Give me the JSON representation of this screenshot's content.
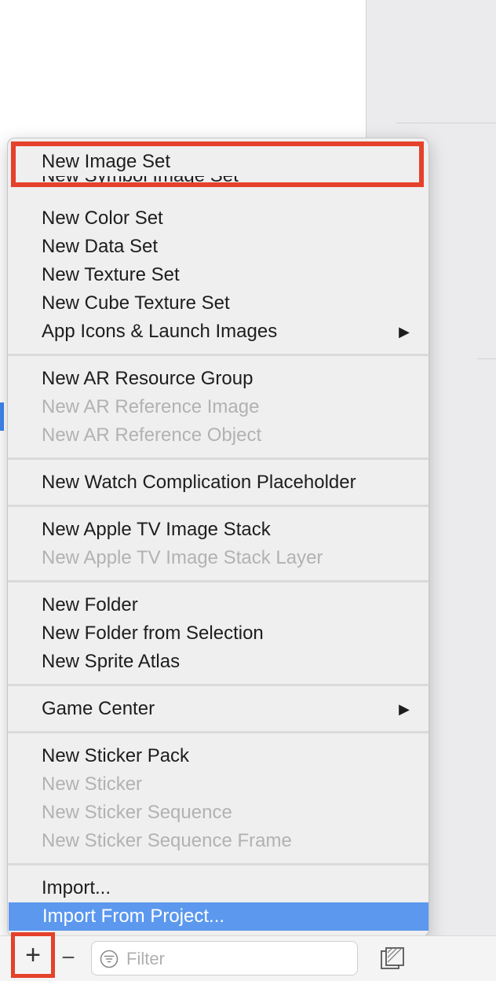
{
  "menu": {
    "items": [
      {
        "label": "New Image Set",
        "enabled": true
      },
      {
        "label": "New Symbol Image Set",
        "enabled": true
      },
      {
        "label": "New Color Set",
        "enabled": true
      },
      {
        "label": "New Data Set",
        "enabled": true
      },
      {
        "label": "New Texture Set",
        "enabled": true
      },
      {
        "label": "New Cube Texture Set",
        "enabled": true
      },
      {
        "label": "App Icons & Launch Images",
        "enabled": true,
        "submenu": true
      },
      {
        "label": "New AR Resource Group",
        "enabled": true
      },
      {
        "label": "New AR Reference Image",
        "enabled": false
      },
      {
        "label": "New AR Reference Object",
        "enabled": false
      },
      {
        "label": "New Watch Complication Placeholder",
        "enabled": true
      },
      {
        "label": "New Apple TV Image Stack",
        "enabled": true
      },
      {
        "label": "New Apple TV Image Stack Layer",
        "enabled": false
      },
      {
        "label": "New Folder",
        "enabled": true
      },
      {
        "label": "New Folder from Selection",
        "enabled": true
      },
      {
        "label": "New Sprite Atlas",
        "enabled": true
      },
      {
        "label": "Game Center",
        "enabled": true,
        "submenu": true
      },
      {
        "label": "New Sticker Pack",
        "enabled": true
      },
      {
        "label": "New Sticker",
        "enabled": false
      },
      {
        "label": "New Sticker Sequence",
        "enabled": false
      },
      {
        "label": "New Sticker Sequence Frame",
        "enabled": false
      },
      {
        "label": "Import...",
        "enabled": true
      },
      {
        "label": "Import From Project...",
        "enabled": true,
        "selected": true
      }
    ],
    "submenu_glyph": "▶"
  },
  "toolbar": {
    "add_label": "+",
    "remove_label": "−",
    "filter_placeholder": "Filter"
  },
  "icons": {
    "filter": "filter-circle-icon",
    "right_tool": "asset-catalog-icon"
  },
  "colors": {
    "highlight_frame": "#e5412b",
    "selection": "#5b98ee",
    "disabled_text": "#b2b2b2"
  }
}
